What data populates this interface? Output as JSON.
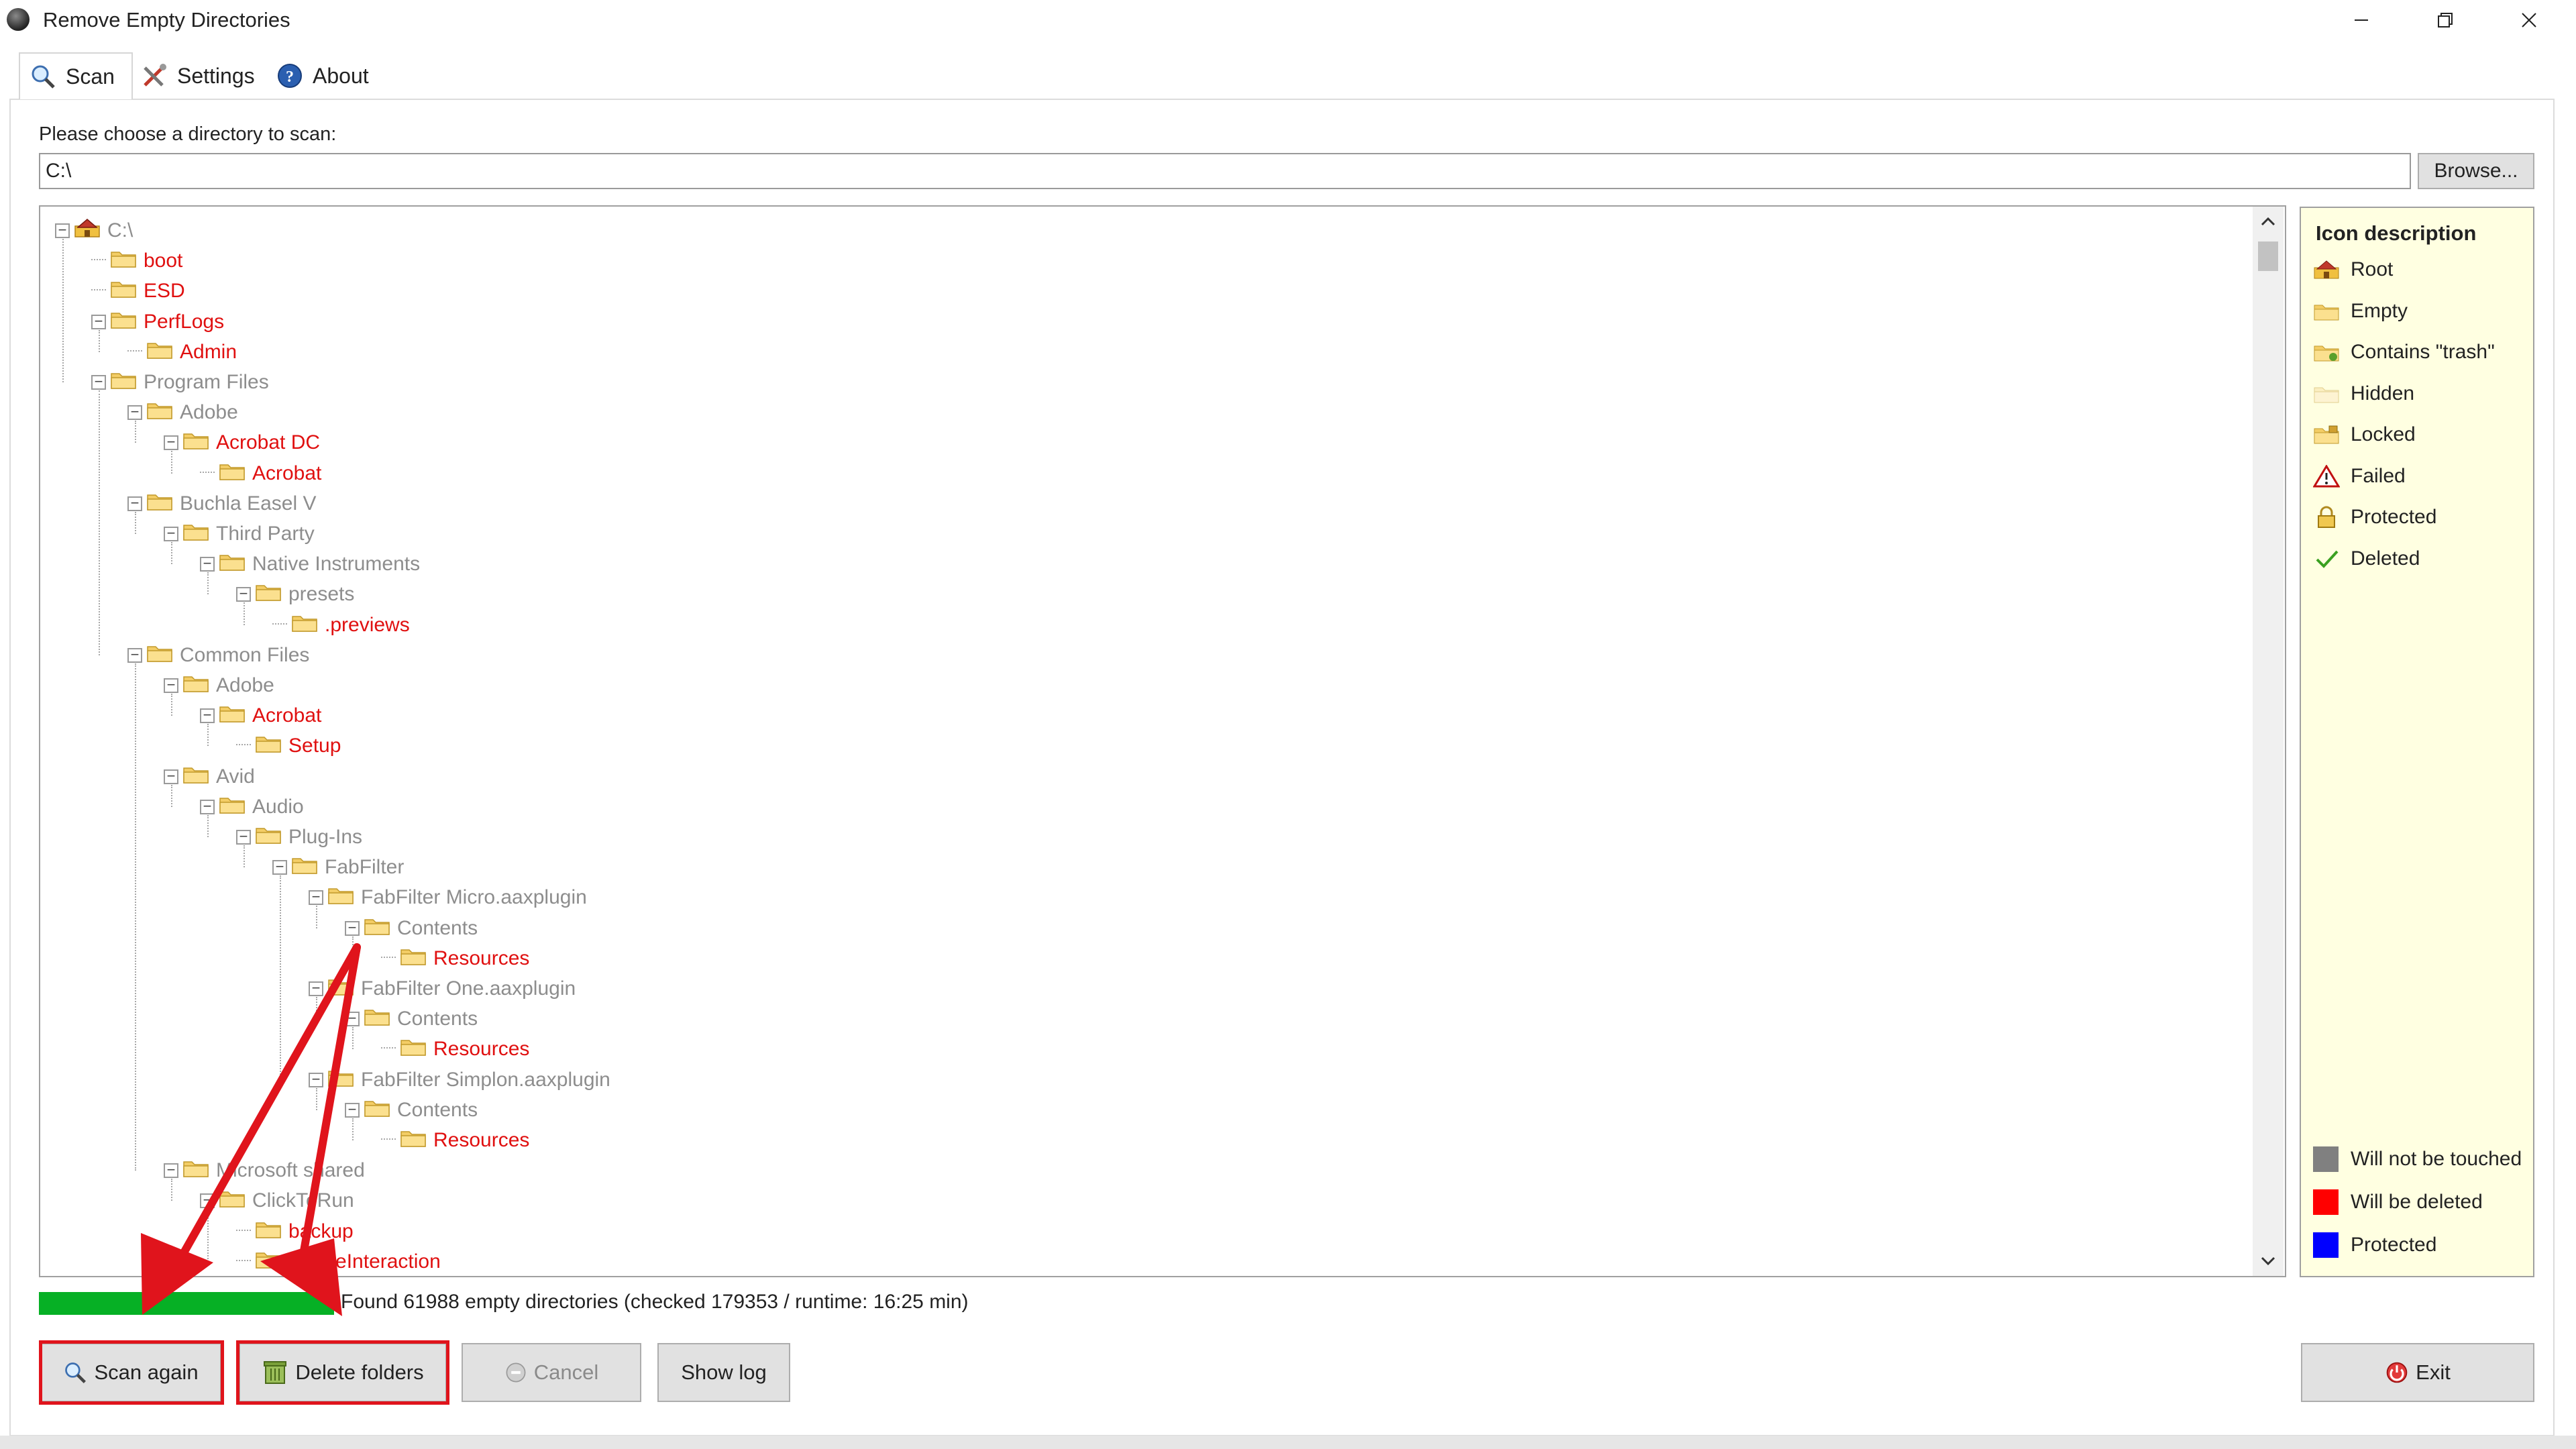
{
  "window": {
    "title": "Remove Empty Directories",
    "minimize_icon": "minimize-icon",
    "maximize_icon": "restore-icon",
    "close_icon": "close-icon"
  },
  "tabs": [
    {
      "label": "Scan",
      "icon": "magnifier-icon",
      "active": true
    },
    {
      "label": "Settings",
      "icon": "tools-icon",
      "active": false
    },
    {
      "label": "About",
      "icon": "info-icon",
      "active": false
    }
  ],
  "scan": {
    "directory_label": "Please choose a directory to scan:",
    "directory_value": "C:\\",
    "browse_label": "Browse..."
  },
  "tree": [
    {
      "name": "C:\\",
      "type": "root",
      "status": "untouched",
      "expander": "minus"
    },
    {
      "name": "boot",
      "status": "deleted"
    },
    {
      "name": "ESD",
      "status": "deleted"
    },
    {
      "name": "PerfLogs",
      "status": "deleted",
      "expander": "minus"
    },
    {
      "name": "Admin",
      "status": "deleted"
    },
    {
      "name": "Program Files",
      "status": "untouched",
      "expander": "minus"
    },
    {
      "name": "Adobe",
      "status": "untouched",
      "expander": "minus"
    },
    {
      "name": "Acrobat DC",
      "status": "deleted",
      "expander": "minus"
    },
    {
      "name": "Acrobat",
      "status": "deleted"
    },
    {
      "name": "Buchla Easel V",
      "status": "untouched",
      "expander": "minus"
    },
    {
      "name": "Third Party",
      "status": "untouched",
      "expander": "minus"
    },
    {
      "name": "Native Instruments",
      "status": "untouched",
      "expander": "minus"
    },
    {
      "name": "presets",
      "status": "untouched",
      "expander": "minus"
    },
    {
      "name": ".previews",
      "status": "deleted"
    },
    {
      "name": "Common Files",
      "status": "untouched",
      "expander": "minus"
    },
    {
      "name": "Adobe",
      "status": "untouched",
      "expander": "minus"
    },
    {
      "name": "Acrobat",
      "status": "deleted",
      "expander": "minus"
    },
    {
      "name": "Setup",
      "status": "deleted"
    },
    {
      "name": "Avid",
      "status": "untouched",
      "expander": "minus"
    },
    {
      "name": "Audio",
      "status": "untouched",
      "expander": "minus"
    },
    {
      "name": "Plug-Ins",
      "status": "untouched",
      "expander": "minus"
    },
    {
      "name": "FabFilter",
      "status": "untouched",
      "expander": "minus"
    },
    {
      "name": "FabFilter Micro.aaxplugin",
      "status": "untouched",
      "expander": "minus"
    },
    {
      "name": "Contents",
      "status": "untouched",
      "expander": "minus"
    },
    {
      "name": "Resources",
      "status": "deleted"
    },
    {
      "name": "FabFilter One.aaxplugin",
      "status": "untouched",
      "expander": "minus"
    },
    {
      "name": "Contents",
      "status": "untouched",
      "expander": "minus"
    },
    {
      "name": "Resources",
      "status": "deleted"
    },
    {
      "name": "FabFilter Simplon.aaxplugin",
      "status": "untouched",
      "expander": "minus"
    },
    {
      "name": "Contents",
      "status": "untouched",
      "expander": "minus"
    },
    {
      "name": "Resources",
      "status": "deleted"
    },
    {
      "name": "Microsoft shared",
      "status": "untouched",
      "expander": "minus"
    },
    {
      "name": "ClickToRun",
      "status": "untouched",
      "expander": "minus"
    },
    {
      "name": "backup",
      "status": "deleted"
    },
    {
      "name": "OnlineInteraction",
      "status": "deleted"
    }
  ],
  "legend": {
    "title": "Icon description",
    "icons": [
      {
        "label": "Root",
        "icon": "root-folder-icon"
      },
      {
        "label": "Empty",
        "icon": "empty-folder-icon"
      },
      {
        "label": "Contains \"trash\"",
        "icon": "trash-folder-icon"
      },
      {
        "label": "Hidden",
        "icon": "hidden-folder-icon"
      },
      {
        "label": "Locked",
        "icon": "locked-folder-icon"
      },
      {
        "label": "Failed",
        "icon": "warning-icon"
      },
      {
        "label": "Protected",
        "icon": "padlock-icon"
      },
      {
        "label": "Deleted",
        "icon": "checkmark-icon"
      }
    ],
    "colors": [
      {
        "label": "Will not be touched",
        "color": "#808080"
      },
      {
        "label": "Will be deleted",
        "color": "#ff0000"
      },
      {
        "label": "Protected",
        "color": "#0000ff"
      }
    ]
  },
  "progress": {
    "value": 1.0
  },
  "status_text": "Found 61988 empty directories (checked 179353 / runtime: 16:25 min)",
  "buttons": {
    "scan_again": "Scan again",
    "delete_folders": "Delete folders",
    "cancel": "Cancel",
    "show_log": "Show log",
    "exit": "Exit"
  },
  "colors": {
    "deleted_text": "#e01010",
    "untouched_text": "#8d8d8d",
    "progress": "#06b025",
    "annotation": "#e0141c"
  }
}
